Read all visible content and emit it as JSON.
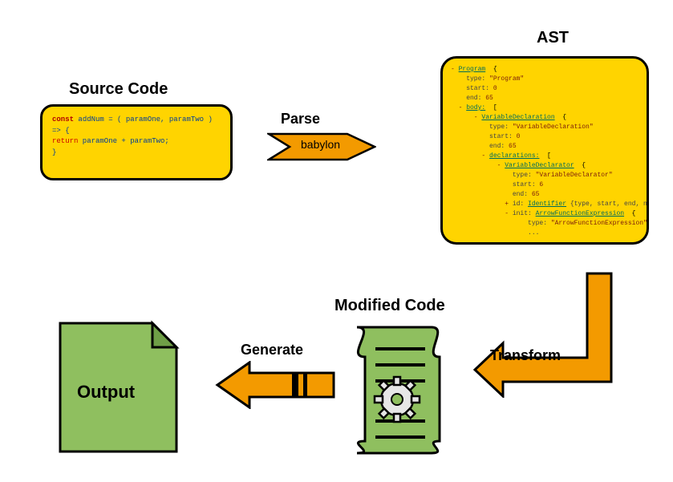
{
  "diagram": {
    "nodes": {
      "source": {
        "title": "Source Code",
        "code_line1_kw": "const",
        "code_line1_ident": " addNum = ( paramOne, paramTwo ) => {",
        "code_line2_ret": "  return",
        "code_line2_rest": " paramOne + paramTwo;",
        "code_line3": "}"
      },
      "ast": {
        "title": "AST",
        "lines": {
          "l1a": "- ",
          "l1b": "Program",
          "l1c": "  {",
          "l2a": "    type: ",
          "l2b": "\"Program\"",
          "l3a": "    start: ",
          "l3b": "0",
          "l4a": "    end: ",
          "l4b": "65",
          "l5a": "  - ",
          "l5b": "body:",
          "l5c": "  [",
          "l6a": "      - ",
          "l6b": "VariableDeclaration",
          "l6c": "  {",
          "l7a": "          type: ",
          "l7b": "\"VariableDeclaration\"",
          "l8a": "          start: ",
          "l8b": "0",
          "l9a": "          end: ",
          "l9b": "65",
          "l10a": "        - ",
          "l10b": "declarations:",
          "l10c": "  [",
          "l11a": "            - ",
          "l11b": "VariableDeclarator",
          "l11c": "  {",
          "l12a": "                type: ",
          "l12b": "\"VariableDeclarator\"",
          "l13a": "                start: ",
          "l13b": "6",
          "l14a": "                end: ",
          "l14b": "65",
          "l15a": "              + ",
          "l15b": "id: ",
          "l15c": "Identifier",
          "l15d": " {type, start, end, name}",
          "l16a": "              - ",
          "l16b": "init: ",
          "l16c": "ArrowFunctionExpression",
          "l16d": "  {",
          "l17a": "                    type: ",
          "l17b": "\"ArrowFunctionExpression\"",
          "l18a": "                    ...",
          "l18b": ""
        }
      },
      "modified": {
        "title": "Modified Code"
      },
      "output": {
        "title": "Output"
      }
    },
    "edges": {
      "parse": {
        "label_top": "Parse",
        "label_inside": "babylon"
      },
      "transform": {
        "label": "Transform"
      },
      "generate": {
        "label": "Generate"
      }
    }
  }
}
